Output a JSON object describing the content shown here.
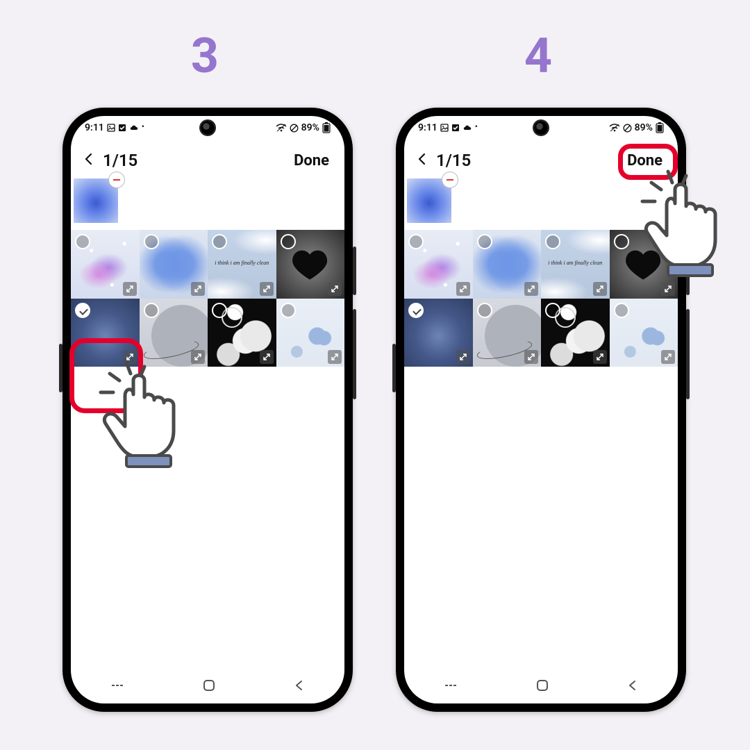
{
  "steps": {
    "left": "3",
    "right": "4"
  },
  "status": {
    "time": "9:11",
    "battery_text": "89%"
  },
  "header": {
    "count_current": 1,
    "count_total": 15,
    "counter_text": "1/15",
    "done_label": "Done"
  },
  "gallery": {
    "preview": {
      "name": "blue-gradient",
      "removable": true
    },
    "tiles": [
      {
        "name": "butterfly",
        "selected": false
      },
      {
        "name": "blue-heart-blur",
        "selected": false
      },
      {
        "name": "quote-card",
        "selected": false,
        "caption": "i think i am finally clean"
      },
      {
        "name": "dark-heart",
        "selected": false
      },
      {
        "name": "navy-gradient",
        "selected": true
      },
      {
        "name": "grey-planet",
        "selected": false
      },
      {
        "name": "night-clouds",
        "selected": false
      },
      {
        "name": "sky-clouds",
        "selected": false
      }
    ]
  },
  "annotations": {
    "left_highlight": "gallery-tile-navy-gradient",
    "right_highlight": "done-button"
  }
}
